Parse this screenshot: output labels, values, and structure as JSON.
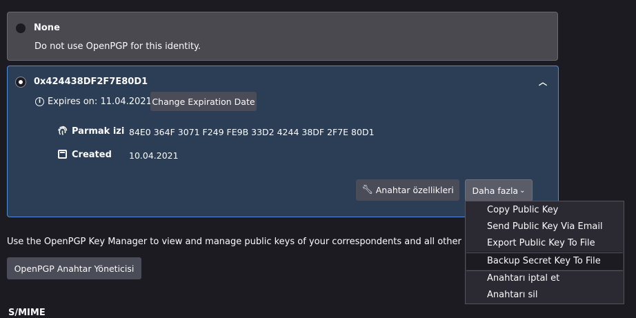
{
  "none_option": {
    "title": "None",
    "description": "Do not use OpenPGP for this identity."
  },
  "key_card": {
    "key_id": "0x424438DF2F7E80D1",
    "expires": "Expires on: 11.04.2021",
    "change_expiration_label": "Change Expiration Date",
    "fingerprint_label": "Parmak izi",
    "fingerprint_value": "84E0 364F 3071 F249 FE9B 33D2 4244 38DF 2F7E 80D1",
    "created_label": "Created",
    "created_value": "10.04.2021",
    "key_properties_label": "Anahtar özellikleri",
    "more_label": "Daha fazla"
  },
  "manager": {
    "description": "Use the OpenPGP Key Manager to view and manage public keys of your correspondents and all other keys",
    "button_label": "OpenPGP Anahtar Yöneticisi"
  },
  "smime_heading": "S/MIME",
  "more_menu": {
    "items": [
      "Copy Public Key",
      "Send Public Key Via Email",
      "Export Public Key To File",
      "Backup Secret Key To File",
      "Anahtarı iptal et",
      "Anahtarı sil"
    ]
  },
  "icons": {
    "info": "info-icon",
    "fingerprint": "fingerprint-icon",
    "calendar": "calendar-icon",
    "wrench": "wrench-icon",
    "chevron_up": "chevron-up-icon",
    "chevron_down": "chevron-down-icon"
  }
}
